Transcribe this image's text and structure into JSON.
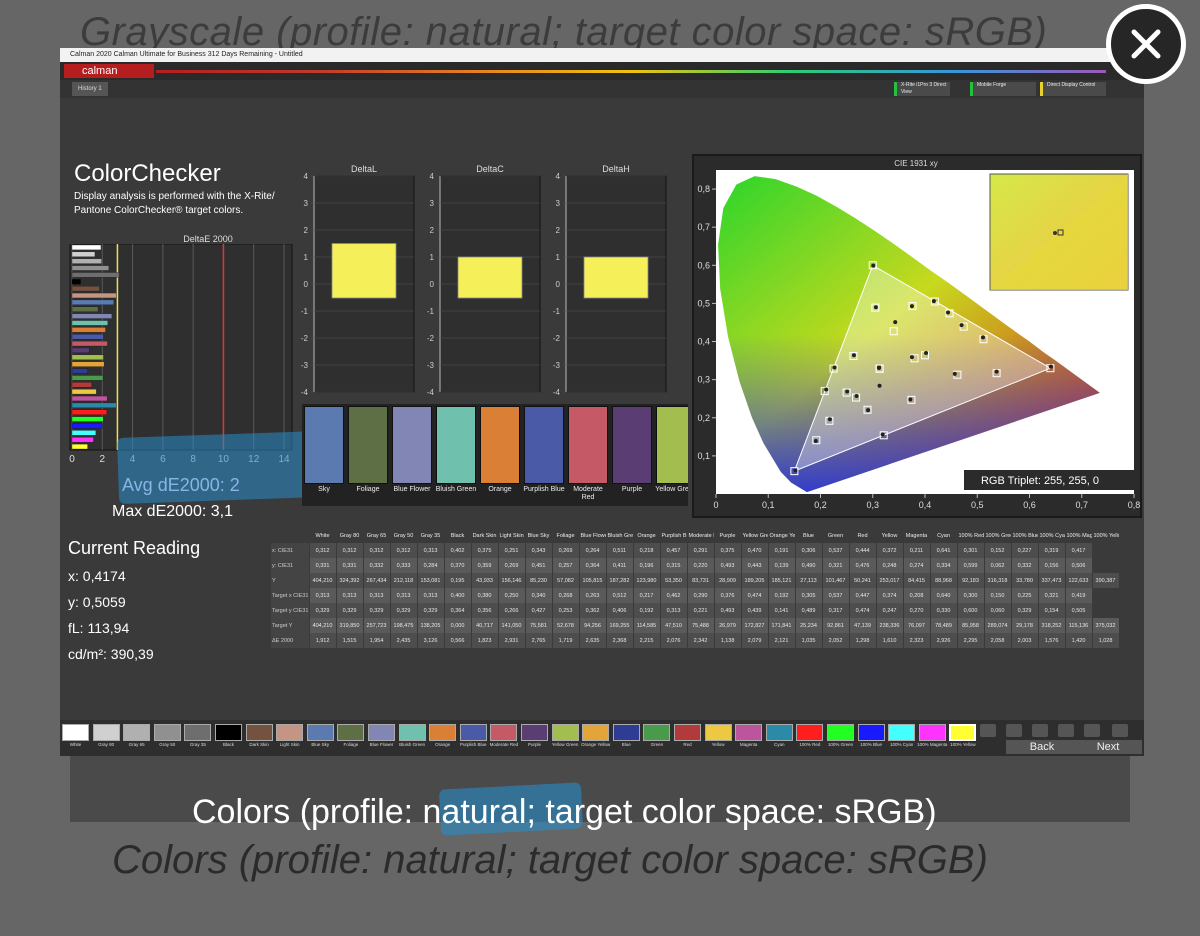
{
  "bg_title": "Grayscale (profile: natural; target color space: sRGB)",
  "bg_caption": "Colors (profile: natural; target color space: sRGB)",
  "caption": "Colors (profile: natural; target color space: sRGB)",
  "app": {
    "window_title": "Calman 2020 Calman Ultimate for Business 312 Days Remaining - Untitled",
    "logo": "calman",
    "tab": "History 1",
    "devices": [
      "X-Rite i1Pro 3 Direct View",
      "Mobile Forge",
      "Direct Display Control"
    ]
  },
  "colorchecker": {
    "title": "ColorChecker",
    "description": "Display analysis is performed with the X-Rite/ Pantone ColorChecker® target colors."
  },
  "deltae_chart": {
    "title": "DeltaE 2000",
    "ticks": [
      "0",
      "2",
      "4",
      "6",
      "8",
      "10",
      "12",
      "14"
    ]
  },
  "delta_charts": [
    {
      "title": "DeltaL",
      "value": 1.5
    },
    {
      "title": "DeltaC",
      "value": 1.0
    },
    {
      "title": "DeltaH",
      "value": 1.0
    }
  ],
  "delta_ticks": [
    "4",
    "3",
    "2",
    "1",
    "0",
    "-1",
    "-2",
    "-3",
    "-4"
  ],
  "summary": {
    "avg": "Avg dE2000: 2",
    "max": "Max dE2000: 3,1"
  },
  "current_reading": {
    "title": "Current Reading",
    "x": "x: 0,4174",
    "y": "y: 0,5059",
    "fl": "fL: 113,94",
    "cdm2": "cd/m²: 390,39"
  },
  "swatches": [
    {
      "label": "Sky",
      "color": "#5b7bb0"
    },
    {
      "label": "Foliage",
      "color": "#5e6f45"
    },
    {
      "label": "Blue Flower",
      "color": "#8186b5"
    },
    {
      "label": "Bluish Green",
      "color": "#6fc0ad"
    },
    {
      "label": "Orange",
      "color": "#d97f36"
    },
    {
      "label": "Purplish Blue",
      "color": "#4a5aa6"
    },
    {
      "label": "Moderate Red",
      "color": "#c55a66"
    },
    {
      "label": "Purple",
      "color": "#5a3d73"
    },
    {
      "label": "Yellow Green",
      "color": "#a3be4e"
    }
  ],
  "cie": {
    "title": "CIE 1931 xy",
    "rgb_triplet": "RGB Triplet: 255, 255, 0",
    "x_ticks": [
      "0",
      "0,1",
      "0,2",
      "0,3",
      "0,4",
      "0,5",
      "0,6",
      "0,7",
      "0,8"
    ],
    "y_ticks": [
      "0,1",
      "0,2",
      "0,3",
      "0,4",
      "0,5",
      "0,6",
      "0,7",
      "0,8"
    ]
  },
  "table": {
    "columns": [
      "",
      "White",
      "Gray 80",
      "Gray 65",
      "Gray 50",
      "Gray 35",
      "Black",
      "Dark Skin",
      "Light Skin",
      "Blue Sky",
      "Foliage",
      "Blue Flower",
      "Bluish Green",
      "Orange",
      "Purplish Blue",
      "Moderate Red",
      "Purple",
      "Yellow Green",
      "Orange Yellow",
      "Blue",
      "Green",
      "Red",
      "Yellow",
      "Magenta",
      "Cyan",
      "100% Red",
      "100% Green",
      "100% Blue",
      "100% Cyan",
      "100% Magenta",
      "100% Yellow"
    ],
    "rows": [
      [
        "x: CIE31",
        "0,312",
        "0,312",
        "0,312",
        "0,312",
        "0,313",
        "0,402",
        "0,375",
        "0,251",
        "0,343",
        "0,269",
        "0,264",
        "0,511",
        "0,218",
        "0,457",
        "0,291",
        "0,375",
        "0,470",
        "0,191",
        "0,306",
        "0,537",
        "0,444",
        "0,372",
        "0,211",
        "0,641",
        "0,301",
        "0,152",
        "0,227",
        "0,319",
        "0,417"
      ],
      [
        "y: CIE31",
        "0,331",
        "0,331",
        "0,332",
        "0,333",
        "0,284",
        "0,370",
        "0,359",
        "0,269",
        "0,451",
        "0,257",
        "0,364",
        "0,411",
        "0,196",
        "0,315",
        "0,220",
        "0,493",
        "0,443",
        "0,139",
        "0,490",
        "0,321",
        "0,476",
        "0,248",
        "0,274",
        "0,334",
        "0,599",
        "0,062",
        "0,332",
        "0,156",
        "0,506"
      ],
      [
        "Y",
        "404,210",
        "324,392",
        "267,434",
        "212,118",
        "153,081",
        "0,195",
        "43,933",
        "156,146",
        "85,230",
        "57,082",
        "105,815",
        "187,282",
        "123,980",
        "53,350",
        "83,731",
        "28,909",
        "189,205",
        "185,121",
        "27,113",
        "101,467",
        "50,241",
        "253,017",
        "84,415",
        "88,968",
        "92,183",
        "316,318",
        "33,780",
        "337,473",
        "122,633",
        "390,387"
      ],
      [
        "Target x CIE31",
        "0,313",
        "0,313",
        "0,313",
        "0,313",
        "0,313",
        "0,400",
        "0,380",
        "0,250",
        "0,340",
        "0,268",
        "0,263",
        "0,512",
        "0,217",
        "0,462",
        "0,290",
        "0,376",
        "0,474",
        "0,192",
        "0,305",
        "0,537",
        "0,447",
        "0,374",
        "0,208",
        "0,640",
        "0,300",
        "0,150",
        "0,225",
        "0,321",
        "0,419"
      ],
      [
        "Target y CIE31",
        "0,329",
        "0,329",
        "0,329",
        "0,329",
        "0,329",
        "0,364",
        "0,356",
        "0,266",
        "0,427",
        "0,253",
        "0,362",
        "0,406",
        "0,192",
        "0,313",
        "0,221",
        "0,493",
        "0,439",
        "0,141",
        "0,489",
        "0,317",
        "0,474",
        "0,247",
        "0,270",
        "0,330",
        "0,600",
        "0,060",
        "0,329",
        "0,154",
        "0,505"
      ],
      [
        "Target Y",
        "404,210",
        "319,850",
        "257,723",
        "198,475",
        "138,205",
        "0,000",
        "40,717",
        "141,050",
        "75,581",
        "52,678",
        "94,256",
        "169,255",
        "114,585",
        "47,510",
        "75,488",
        "26,979",
        "172,827",
        "171,841",
        "25,234",
        "92,861",
        "47,139",
        "238,336",
        "76,097",
        "78,489",
        "85,958",
        "289,074",
        "29,178",
        "318,252",
        "115,136",
        "375,032"
      ],
      [
        "ΔE 2000",
        "1,912",
        "1,515",
        "1,954",
        "2,435",
        "3,126",
        "0,566",
        "1,823",
        "2,931",
        "2,765",
        "1,719",
        "2,635",
        "2,368",
        "2,215",
        "2,076",
        "2,342",
        "1,138",
        "2,079",
        "2,121",
        "1,035",
        "2,052",
        "1,298",
        "1,610",
        "2,323",
        "2,926",
        "2,295",
        "2,058",
        "2,003",
        "1,576",
        "1,420",
        "1,028"
      ]
    ]
  },
  "patches": [
    {
      "label": "White",
      "color": "#ffffff"
    },
    {
      "label": "Gray 80",
      "color": "#d0d0d0"
    },
    {
      "label": "Gray 65",
      "color": "#b0b0b0"
    },
    {
      "label": "Gray 50",
      "color": "#909090"
    },
    {
      "label": "Gray 35",
      "color": "#6e6e6e"
    },
    {
      "label": "Black",
      "color": "#000000"
    },
    {
      "label": "Dark Skin",
      "color": "#73523f"
    },
    {
      "label": "Light Skin",
      "color": "#c49583"
    },
    {
      "label": "Blue Sky",
      "color": "#5b7bb0"
    },
    {
      "label": "Foliage",
      "color": "#5e6f45"
    },
    {
      "label": "Blue Flower",
      "color": "#8186b5"
    },
    {
      "label": "Bluish Green",
      "color": "#6fc0ad"
    },
    {
      "label": "Orange",
      "color": "#d97f36"
    },
    {
      "label": "Purplish Blue",
      "color": "#4a5aa6"
    },
    {
      "label": "Moderate Red",
      "color": "#c55a66"
    },
    {
      "label": "Purple",
      "color": "#5a3d73"
    },
    {
      "label": "Yellow Green",
      "color": "#a3be4e"
    },
    {
      "label": "Orange Yellow",
      "color": "#e3a43a"
    },
    {
      "label": "Blue",
      "color": "#2f3c93"
    },
    {
      "label": "Green",
      "color": "#4a9a4c"
    },
    {
      "label": "Red",
      "color": "#b33a3a"
    },
    {
      "label": "Yellow",
      "color": "#ecc940"
    },
    {
      "label": "Magenta",
      "color": "#bd559d"
    },
    {
      "label": "Cyan",
      "color": "#2a8aa8"
    },
    {
      "label": "100% Red",
      "color": "#ff1e1e"
    },
    {
      "label": "100% Green",
      "color": "#22ff22"
    },
    {
      "label": "100% Blue",
      "color": "#1a1aff"
    },
    {
      "label": "100% Cyan",
      "color": "#44ffff"
    },
    {
      "label": "100% Magenta",
      "color": "#ff33ff"
    },
    {
      "label": "100% Yellow",
      "color": "#ffff33"
    }
  ],
  "nav": {
    "back": "Back",
    "next": "Next"
  },
  "colors": {
    "accent_yellow": "#f5f05a",
    "calman_red": "#b51e1e",
    "target_line": "#e33333"
  }
}
